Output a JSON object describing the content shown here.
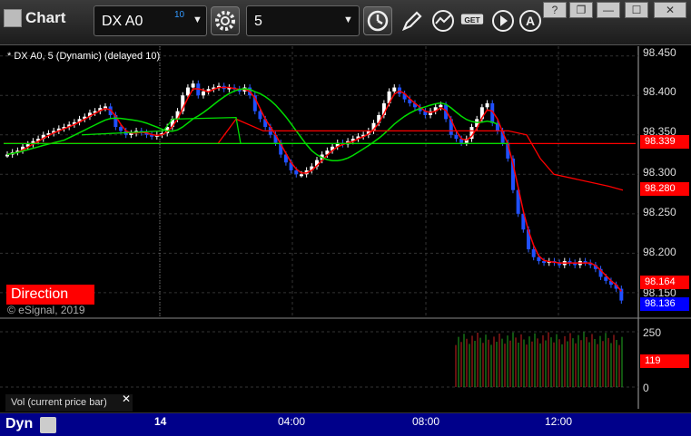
{
  "toolbar": {
    "title": "Chart",
    "symbol": "DX A0",
    "symbol_sup": "10",
    "interval": "5",
    "win_buttons": [
      "?",
      "❐",
      "—",
      "☐",
      "✕"
    ]
  },
  "chart": {
    "series_label": "* DX A0, 5 (Dynamic) (delayed 10)",
    "direction_label": "Direction",
    "copyright": "© eSignal, 2019",
    "price_ticks": [
      "98.450",
      "98.400",
      "98.350",
      "98.300",
      "98.250",
      "98.200",
      "98.150"
    ],
    "price_tags": [
      {
        "text": "98.339",
        "color": "#ff0000"
      },
      {
        "text": "98.280",
        "color": "#ff0000"
      },
      {
        "text": "98.164",
        "color": "#ff0000"
      },
      {
        "text": "98.136",
        "color": "#0000ff"
      }
    ],
    "vol_ticks": [
      "250",
      "0"
    ],
    "vol_tag": "119",
    "vol_label": "Vol (current price bar)",
    "bottom_label": "Dyn",
    "time_labels": [
      "14",
      "04:00",
      "08:00",
      "12:00"
    ]
  },
  "chart_data": {
    "type": "candlestick",
    "ylim": [
      98.12,
      98.46
    ],
    "candles": [
      98.325,
      98.328,
      98.33,
      98.335,
      98.338,
      98.342,
      98.345,
      98.35,
      98.352,
      98.355,
      98.358,
      98.36,
      98.363,
      98.366,
      98.37,
      98.373,
      98.378,
      98.38,
      98.384,
      98.386,
      98.375,
      98.36,
      98.355,
      98.35,
      98.352,
      98.355,
      98.353,
      98.35,
      98.348,
      98.35,
      98.352,
      98.36,
      98.37,
      98.38,
      98.4,
      98.41,
      98.415,
      98.4,
      98.405,
      98.408,
      98.41,
      98.412,
      98.408,
      98.41,
      98.408,
      98.405,
      98.41,
      98.4,
      98.38,
      98.37,
      98.36,
      98.35,
      98.34,
      98.325,
      98.315,
      98.305,
      98.3,
      98.3,
      98.305,
      98.31,
      98.318,
      98.325,
      98.33,
      98.335,
      98.34,
      98.338,
      98.342,
      98.345,
      98.348,
      98.35,
      98.355,
      98.365,
      98.375,
      98.39,
      98.405,
      98.41,
      98.402,
      98.395,
      98.39,
      98.385,
      98.38,
      98.375,
      98.38,
      98.385,
      98.388,
      98.37,
      98.35,
      98.345,
      98.34,
      98.345,
      98.36,
      98.37,
      98.385,
      98.39,
      98.365,
      98.355,
      98.34,
      98.32,
      98.28,
      98.25,
      98.23,
      98.205,
      98.195,
      98.19,
      98.188,
      98.19,
      98.188,
      98.185,
      98.19,
      98.188,
      98.185,
      98.19,
      98.188,
      98.185,
      98.18,
      98.17,
      98.165,
      98.16,
      98.155,
      98.14
    ],
    "lines": [
      {
        "name": "",
        "color": "#ff0000",
        "values": [
          98.339,
          98.339,
          98.339,
          98.339,
          98.339
        ]
      },
      {
        "name": "",
        "color": "#00ff00",
        "values": [
          98.339,
          98.339,
          98.339,
          98.339,
          98.339
        ]
      }
    ],
    "volume_ylim": [
      0,
      250
    ]
  }
}
